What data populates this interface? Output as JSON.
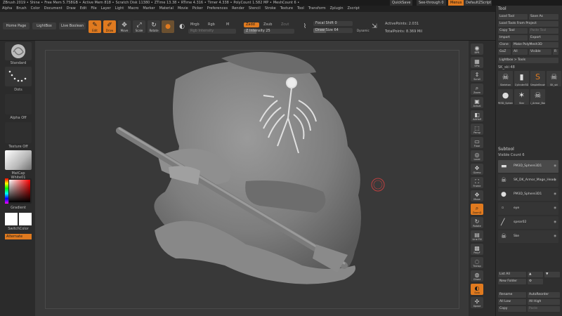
{
  "titlebar": {
    "segments": [
      "ZBrush 2019",
      "Shine",
      "Free Mem 5.758GB",
      "Active Mem 818",
      "Scratch Disk 11380",
      "ZTime 13.38",
      "RTime 4.316",
      "Timer 4.338",
      "PolyCount 1.582 MP",
      "MeshCount 6"
    ],
    "quicksave": "QuickSave",
    "seethrough": "See-through 0",
    "menus_btn": "Menus",
    "ui_layout": "DefaultZScript"
  },
  "menubar": [
    "Alpha",
    "Brush",
    "Color",
    "Document",
    "Draw",
    "Edit",
    "File",
    "Layer",
    "Light",
    "Macro",
    "Marker",
    "Material",
    "Movie",
    "Picker",
    "Preferences",
    "Render",
    "Stencil",
    "Stroke",
    "Texture",
    "Tool",
    "Transform",
    "Zplugin",
    "Zscript"
  ],
  "shelf": {
    "home_page": "Home Page",
    "lightbox": "LightBox",
    "live_boolean": "Live Boolean",
    "edit": "Edit",
    "draw": "Draw",
    "move": "Move",
    "scale": "Scale",
    "rotate": "Rotate",
    "mrgb": "Mrgb",
    "rgb": "Rgb",
    "m": "M",
    "zadd": "Zadd",
    "zsub": "Zsub",
    "zcut": "Zcut",
    "rgb_intensity": "Rgb Intensity",
    "z_intensity": "Z Intensity 25",
    "z_intensity_value": 25,
    "focal_shift": "Focal Shift 0",
    "draw_size": "Draw Size 64",
    "draw_size_value": 64,
    "dynamic": "Dynamic",
    "active_points": "ActivePoints: 2.031",
    "total_points": "TotalPoints: 8.369 Mil"
  },
  "lefttray": {
    "brush": "Standard",
    "stroke": "Dots",
    "alpha": "Alpha Off",
    "texture": "Texture Off",
    "material": "MatCap White01",
    "gradient": "Gradient",
    "switch_color": "SwitchColor",
    "alternate": "Alternate"
  },
  "rightstrip": [
    "BPR",
    "SPix",
    "Scroll",
    "Zoom",
    "Actual",
    "AAHalf",
    "Persp",
    "Floor",
    "Local",
    "Gizmo",
    "Frame",
    "Move",
    "ZoomD",
    "Rotate",
    "Line Fill",
    "PolyF",
    "Transp",
    "Ghost",
    "Solo",
    "Xpose"
  ],
  "rightpanel": {
    "tool_title": "Tool",
    "load_tool": "Load Tool",
    "save_as": "Save As",
    "load_tools_from_project": "Load Tools From Project",
    "copy_tool": "Copy Tool",
    "paste_tool": "Paste Tool",
    "import": "Import",
    "export": "Export",
    "clone": "Clone",
    "make_polymesh": "Make PolyMesh3D",
    "goz": "GoZ",
    "all": "All",
    "visible": "Visible",
    "r": "R",
    "lightbox_tools": "Lightbox > Tools",
    "current_tool": "SK_ski 48",
    "thumbs": [
      "Skeleton",
      "Cylinder3D",
      "SimpleBrush",
      "SK_ski",
      "PM3D_Sphere",
      "Star",
      "SK_Armor_Body"
    ],
    "subtool_title": "Subtool",
    "visible_count": "Visible Count 6",
    "subtools": [
      "PM3D_Sphere3D1",
      "SK_DK_Armor_Mage_Head",
      "PM3D_Sphere3D1",
      "eye",
      "spear02",
      "Ske"
    ],
    "list_all": "List All",
    "new_folder": "New Folder",
    "rename": "Rename",
    "auto_reorder": "AutoReorder",
    "all_low": "All Low",
    "all_high": "All High",
    "copy": "Copy",
    "paste": "Paste"
  },
  "viewport": {
    "cursor": "brush-cursor"
  }
}
